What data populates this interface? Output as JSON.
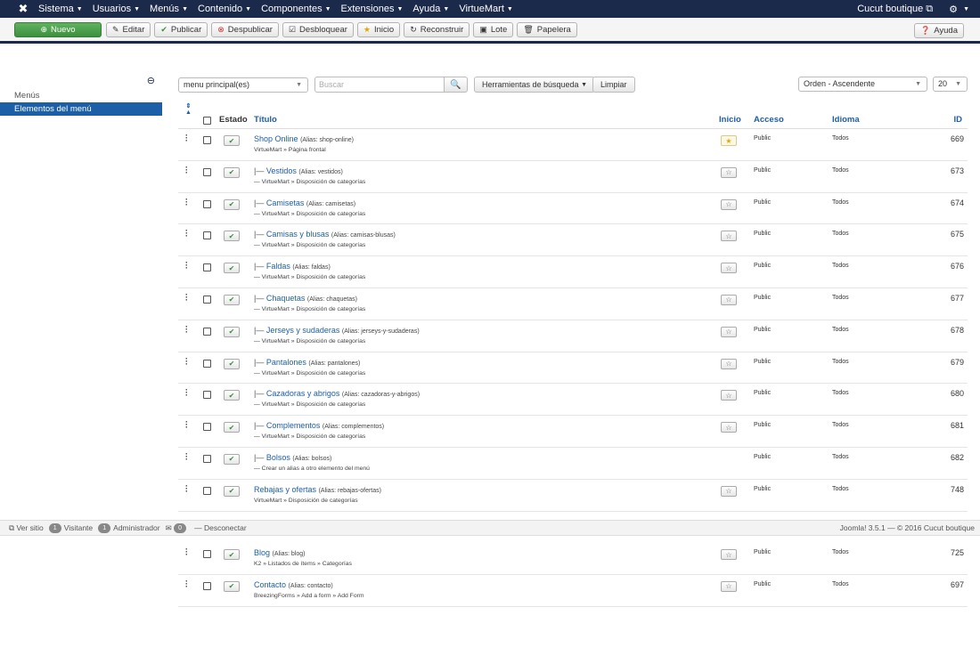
{
  "navbar": {
    "menu": [
      {
        "label": "Sistema",
        "caret": true
      },
      {
        "label": "Usuarios",
        "caret": true
      },
      {
        "label": "Menús",
        "caret": true
      },
      {
        "label": "Contenido",
        "caret": true
      },
      {
        "label": "Componentes",
        "caret": true
      },
      {
        "label": "Extensiones",
        "caret": true
      },
      {
        "label": "Ayuda",
        "caret": true
      },
      {
        "label": "VirtueMart",
        "caret": true
      }
    ],
    "site_name": "Cucut boutique"
  },
  "toolbar": {
    "nuevo": "Nuevo",
    "editar": "Editar",
    "publicar": "Publicar",
    "despublicar": "Despublicar",
    "desbloquear": "Desbloquear",
    "inicio": "Inicio",
    "reconstruir": "Reconstruir",
    "lote": "Lote",
    "papelera": "Papelera",
    "ayuda": "Ayuda"
  },
  "sidebar": {
    "items": [
      {
        "label": "Menús",
        "active": false
      },
      {
        "label": "Elementos del menú",
        "active": true
      }
    ]
  },
  "filters": {
    "menu_select": "menu principal(es)",
    "search_placeholder": "Buscar",
    "search_tools": "Herramientas de búsqueda",
    "clear": "Limpiar",
    "order_select": "Orden - Ascendente",
    "limit_select": "20"
  },
  "table": {
    "headers": {
      "estado": "Estado",
      "titulo": "Título",
      "inicio": "Inicio",
      "acceso": "Acceso",
      "idioma": "Idioma",
      "id": "ID"
    },
    "rows": [
      {
        "prefix": "",
        "title": "Shop Online",
        "alias": "(Alias: shop-online)",
        "sub": "VirtueMart » Página frontal",
        "home": "default",
        "access": "Public",
        "lang": "Todos",
        "id": "669"
      },
      {
        "prefix": "|— ",
        "title": "Vestidos",
        "alias": "(Alias: vestidos)",
        "sub": "— VirtueMart » Disposición de categorías",
        "home": "star",
        "access": "Public",
        "lang": "Todos",
        "id": "673"
      },
      {
        "prefix": "|— ",
        "title": "Camisetas",
        "alias": "(Alias: camisetas)",
        "sub": "— VirtueMart » Disposición de categorías",
        "home": "star",
        "access": "Public",
        "lang": "Todos",
        "id": "674"
      },
      {
        "prefix": "|— ",
        "title": "Camisas y blusas",
        "alias": "(Alias: camisas-blusas)",
        "sub": "— VirtueMart » Disposición de categorías",
        "home": "star",
        "access": "Public",
        "lang": "Todos",
        "id": "675"
      },
      {
        "prefix": "|— ",
        "title": "Faldas",
        "alias": "(Alias: faldas)",
        "sub": "— VirtueMart » Disposición de categorías",
        "home": "star",
        "access": "Public",
        "lang": "Todos",
        "id": "676"
      },
      {
        "prefix": "|— ",
        "title": "Chaquetas",
        "alias": "(Alias: chaquetas)",
        "sub": "— VirtueMart » Disposición de categorías",
        "home": "star",
        "access": "Public",
        "lang": "Todos",
        "id": "677"
      },
      {
        "prefix": "|— ",
        "title": "Jerseys y sudaderas",
        "alias": "(Alias: jerseys-y-sudaderas)",
        "sub": "— VirtueMart » Disposición de categorías",
        "home": "star",
        "access": "Public",
        "lang": "Todos",
        "id": "678"
      },
      {
        "prefix": "|— ",
        "title": "Pantalones",
        "alias": "(Alias: pantalones)",
        "sub": "— VirtueMart » Disposición de categorías",
        "home": "star",
        "access": "Public",
        "lang": "Todos",
        "id": "679"
      },
      {
        "prefix": "|— ",
        "title": "Cazadoras y abrigos",
        "alias": "(Alias: cazadoras-y-abrigos)",
        "sub": "— VirtueMart » Disposición de categorías",
        "home": "star",
        "access": "Public",
        "lang": "Todos",
        "id": "680"
      },
      {
        "prefix": "|— ",
        "title": "Complementos",
        "alias": "(Alias: complementos)",
        "sub": "— VirtueMart » Disposición de categorías",
        "home": "star",
        "access": "Public",
        "lang": "Todos",
        "id": "681"
      },
      {
        "prefix": "|— ",
        "title": "Bolsos",
        "alias": "(Alias: bolsos)",
        "sub": "— Crear un alias a otro elemento del menú",
        "home": "none",
        "access": "Public",
        "lang": "Todos",
        "id": "682"
      },
      {
        "prefix": "",
        "title": "Rebajas y ofertas",
        "alias": "(Alias: rebajas-ofertas)",
        "sub": "VirtueMart » Disposición de categorías",
        "home": "star",
        "access": "Public",
        "lang": "Todos",
        "id": "748"
      }
    ],
    "rows_after": [
      {
        "prefix": "",
        "title": "Blog",
        "alias": "(Alias: blog)",
        "sub": "K2 » Listados de ítems » Categorías",
        "home": "star",
        "access": "Public",
        "lang": "Todos",
        "id": "725"
      },
      {
        "prefix": "",
        "title": "Contacto",
        "alias": "(Alias: contacto)",
        "sub": "BreezingForms » Add a form » Add Form",
        "home": "star",
        "access": "Public",
        "lang": "Todos",
        "id": "697"
      }
    ]
  },
  "statusbar": {
    "ver_sitio": "Ver sitio",
    "visitante_count": "1",
    "visitante": "Visitante",
    "admin_count": "1",
    "administrador": "Administrador",
    "messages_count": "0",
    "desconectar": "Desconectar",
    "footer": "Joomla! 3.5.1 — © 2016 Cucut boutique"
  }
}
